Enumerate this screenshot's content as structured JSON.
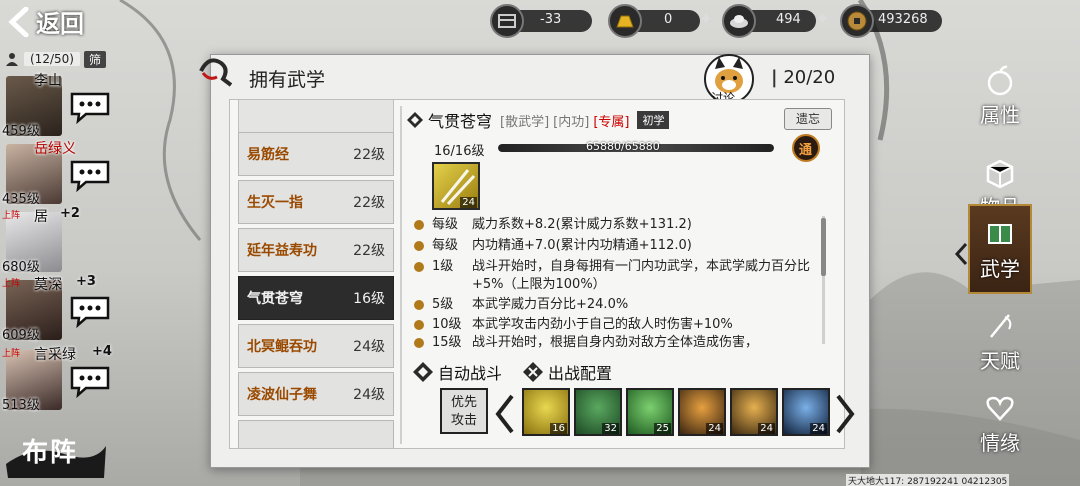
{
  "nav": {
    "back_label": "返回"
  },
  "resources": [
    {
      "icon": "armor-icon",
      "value": "-33",
      "has_plus": false
    },
    {
      "icon": "gold-bar-icon",
      "value": "0",
      "has_plus": true
    },
    {
      "icon": "silver-ingot-icon",
      "value": "494",
      "has_plus": true
    },
    {
      "icon": "copper-coin-icon",
      "value": "493268",
      "has_plus": false
    }
  ],
  "roster": {
    "count": "(12/50)",
    "filter_label": "筛",
    "characters": [
      {
        "name": "李山",
        "level": "459级",
        "name_color": "#111111",
        "on_field": "",
        "rank_plus": ""
      },
      {
        "name": "岳绿义",
        "level": "435级",
        "name_color": "#b40000",
        "on_field": "",
        "rank_plus": ""
      },
      {
        "name": "居",
        "level": "680级",
        "name_color": "#111111",
        "on_field": "上阵",
        "rank_plus": "+2"
      },
      {
        "name": "莫深",
        "level": "609级",
        "name_color": "#111111",
        "on_field": "上阵",
        "rank_plus": "+3"
      },
      {
        "name": "言采绿",
        "level": "513级",
        "name_color": "#111111",
        "on_field": "上阵",
        "rank_plus": "+4"
      }
    ],
    "formation_label": "布阵"
  },
  "panel": {
    "title": "拥有武学",
    "mascot_label": "讨论",
    "count": "20/20"
  },
  "skill_list": [
    {
      "name": "易筋经",
      "level": "22级",
      "selected": false
    },
    {
      "name": "生灭一指",
      "level": "22级",
      "selected": false
    },
    {
      "name": "延年益寿功",
      "level": "22级",
      "selected": false
    },
    {
      "name": "气贯苍穹",
      "level": "16级",
      "selected": true
    },
    {
      "name": "北冥鲲吞功",
      "level": "24级",
      "selected": false
    },
    {
      "name": "凌波仙子舞",
      "level": "24级",
      "selected": false
    }
  ],
  "detail": {
    "name": "气贯苍穹",
    "tags": [
      "[散武学]",
      "[内功]"
    ],
    "exclusive_tag": "[专属]",
    "rank_tag": "初学",
    "forget_label": "遗忘",
    "level_progress": "16/16级",
    "exp_text": "65880/65880",
    "exp_fraction": 1.0,
    "tong_label": "通",
    "icon_level": "24",
    "effects": [
      {
        "level": "每级",
        "text": "威力系数+8.2(累计威力系数+131.2)"
      },
      {
        "level": "每级",
        "text": "内功精通+7.0(累计内功精通+112.0)"
      },
      {
        "level": "1级",
        "text": "战斗开始时，自身每拥有一门内功武学，本武学威力百分比+5%（上限为100%）"
      },
      {
        "level": "5级",
        "text": "本武学威力百分比+24.0%"
      },
      {
        "level": "10级",
        "text": "本武学攻击内劲小于自己的敌人时伤害+10%"
      },
      {
        "level": "15级",
        "text": "战斗开始时，根据自身内劲对敌方全体造成伤害，"
      }
    ],
    "auto_battle_label": "自动战斗",
    "battle_config_label": "出战配置",
    "priority_label_1": "优先",
    "priority_label_2": "攻击",
    "slots": [
      {
        "level": "16",
        "color_a": "#e8d850",
        "color_b": "#8a7010"
      },
      {
        "level": "32",
        "color_a": "#5aa860",
        "color_b": "#1d4a24"
      },
      {
        "level": "25",
        "color_a": "#7cd070",
        "color_b": "#1e5a20"
      },
      {
        "level": "24",
        "color_a": "#e6a040",
        "color_b": "#3a2410"
      },
      {
        "level": "24",
        "color_a": "#e6b050",
        "color_b": "#3a2810"
      },
      {
        "level": "24",
        "color_a": "#7ab0e8",
        "color_b": "#10203a"
      }
    ]
  },
  "watermark": "天大地大117: 287192241 04212305",
  "tabs": [
    {
      "label": "属性",
      "icon": "apple-icon",
      "active": false
    },
    {
      "label": "物品",
      "icon": "box-icon",
      "active": false
    },
    {
      "label": "武学",
      "icon": "book-icon",
      "active": true
    },
    {
      "label": "天赋",
      "icon": "needle-icon",
      "active": false
    },
    {
      "label": "情缘",
      "icon": "heart-icon",
      "active": false
    }
  ]
}
